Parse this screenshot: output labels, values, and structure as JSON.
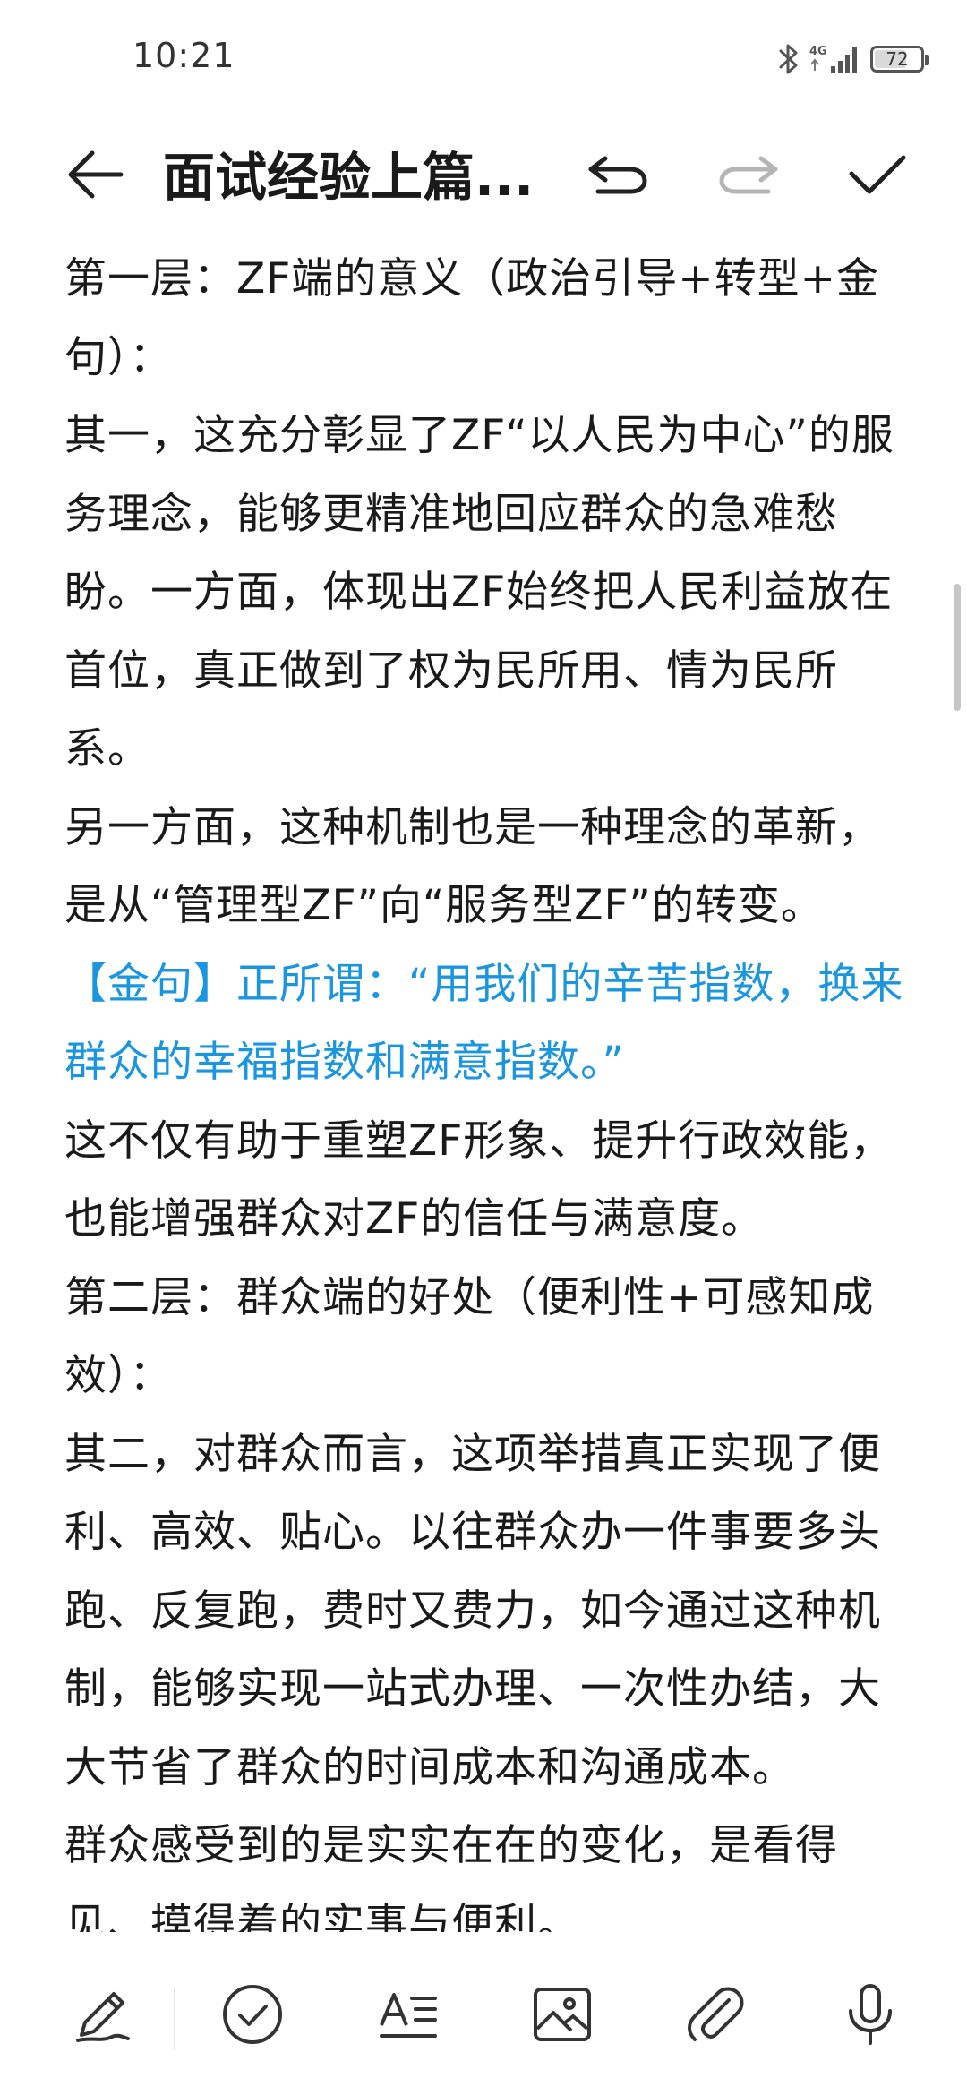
{
  "status_bar": {
    "time": "10:21",
    "network": "4G",
    "battery": "72",
    "battery_percent": 72
  },
  "title_bar": {
    "title": "面试经验上篇..."
  },
  "content": {
    "paragraphs": [
      "第一层：ZF端的意义（政治引导+转型+金句）：",
      "其一，这充分彰显了ZF“以人民为中心”的服务理念，能够更精准地回应群众的急难愁盼。一方面，体现出ZF始终把人民利益放在首位，真正做到了权为民所用、情为民所系。",
      "另一方面，这种机制也是一种理念的革新，是从“管理型ZF”向“服务型ZF”的转变。",
      "【金句】正所谓：“用我们的辛苦指数，换来群众的幸福指数和满意指数。”",
      "这不仅有助于重塑ZF形象、提升行政效能，也能增强群众对ZF的信任与满意度。",
      "第二层：群众端的好处（便利性+可感知成效）：",
      "其二，对群众而言，这项举措真正实现了便利、高效、贴心。以往群众办一件事要多头跑、反复跑，费时又费力，如今通过这种机制，能够实现一站式办理、一次性办结，大大节省了群众的时间成本和沟通成本。",
      "群众感受到的是实实在在的变化，是看得见、摸得着的实事与便利。"
    ]
  },
  "icons": {
    "back": "arrow-left-icon",
    "undo": "undo-icon",
    "redo": "redo-icon",
    "confirm": "check-icon",
    "pen": "pen-icon",
    "checklist": "check-circle-icon",
    "format": "text-format-icon",
    "image": "image-icon",
    "attach": "paperclip-icon",
    "mic": "microphone-icon"
  },
  "colors": {
    "text": "#1a1a1a",
    "highlight": "#1a96e0",
    "disabled": "#b5b5b5"
  }
}
